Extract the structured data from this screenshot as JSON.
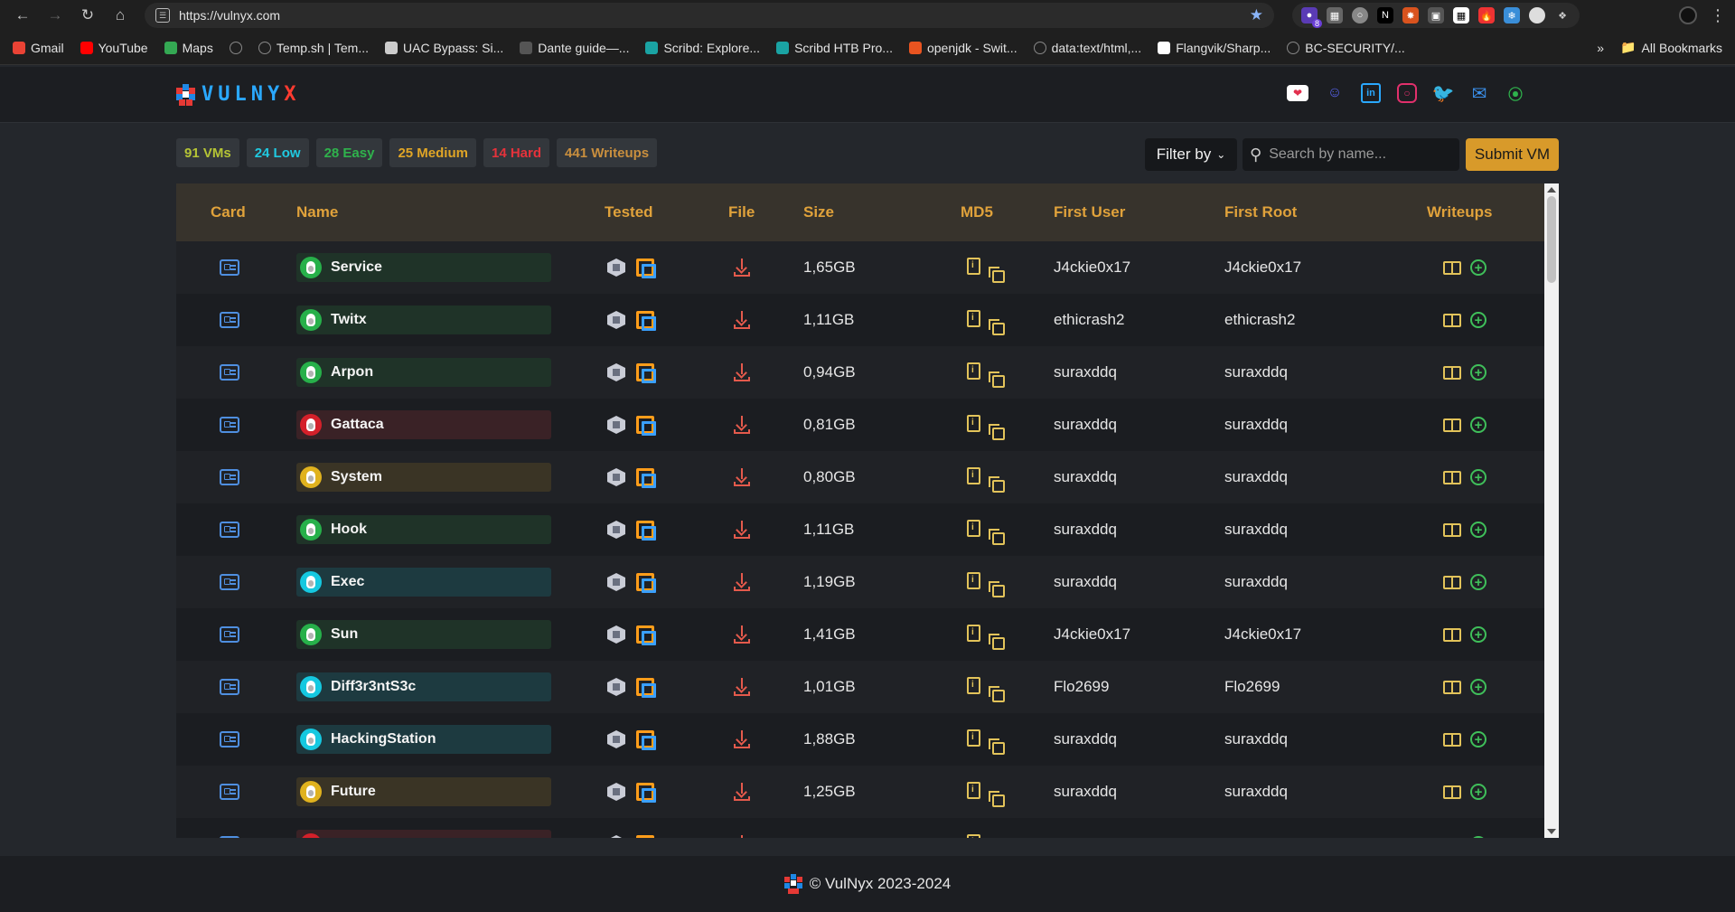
{
  "browser": {
    "url": "https://vulnyx.com",
    "extension_badge": "8",
    "bookmarks": [
      {
        "label": "Gmail",
        "icon": "gmail-icon",
        "color": "#ea4335"
      },
      {
        "label": "YouTube",
        "icon": "youtube-icon",
        "color": "#ff0000"
      },
      {
        "label": "Maps",
        "icon": "maps-icon",
        "color": "#34a853"
      },
      {
        "label": "",
        "icon": "globe-icon",
        "color": "#888888"
      },
      {
        "label": "Temp.sh | Tem...",
        "icon": "globe-icon",
        "color": "#888888"
      },
      {
        "label": "UAC Bypass: Si...",
        "icon": "shield-icon",
        "color": "#cccccc"
      },
      {
        "label": "Dante guide—...",
        "icon": "page-icon",
        "color": "#555555"
      },
      {
        "label": "Scribd: Explore...",
        "icon": "scribd-icon",
        "color": "#1aa3a3"
      },
      {
        "label": "Scribd HTB Pro...",
        "icon": "scribd-icon",
        "color": "#1aa3a3"
      },
      {
        "label": "openjdk - Swit...",
        "icon": "askubuntu-icon",
        "color": "#e95420"
      },
      {
        "label": "data:text/html,...",
        "icon": "globe-icon",
        "color": "#888888"
      },
      {
        "label": "Flangvik/Sharp...",
        "icon": "github-icon",
        "color": "#ffffff"
      },
      {
        "label": "BC-SECURITY/...",
        "icon": "globe-icon",
        "color": "#888888"
      }
    ],
    "all_bookmarks": "All Bookmarks"
  },
  "site": {
    "logo_text_main": "VULNY",
    "logo_text_accent": "X",
    "social_icons": [
      "kofi-icon",
      "discord-icon",
      "linkedin-icon",
      "instagram-icon",
      "twitter-icon",
      "mail-icon",
      "rss-icon"
    ]
  },
  "stats": [
    {
      "label": "91 VMs",
      "color": "#b5c435"
    },
    {
      "label": "24 Low",
      "color": "#20c9e0"
    },
    {
      "label": "28 Easy",
      "color": "#2fb24c"
    },
    {
      "label": "25 Medium",
      "color": "#e0a526"
    },
    {
      "label": "14 Hard",
      "color": "#e5323b"
    },
    {
      "label": "441 Writeups",
      "color": "#c98f3e"
    }
  ],
  "toolbar": {
    "filter_label": "Filter by",
    "search_placeholder": "Search by name...",
    "submit_label": "Submit VM"
  },
  "table": {
    "headers": {
      "card": "Card",
      "name": "Name",
      "tested": "Tested",
      "file": "File",
      "size": "Size",
      "md5": "MD5",
      "first_user": "First User",
      "first_root": "First Root",
      "writeups": "Writeups"
    },
    "rows": [
      {
        "name": "Service",
        "difficulty": "easy",
        "size": "1,65GB",
        "first_user": "J4ckie0x17",
        "first_root": "J4ckie0x17"
      },
      {
        "name": "Twitx",
        "difficulty": "easy",
        "size": "1,11GB",
        "first_user": "ethicrash2",
        "first_root": "ethicrash2"
      },
      {
        "name": "Arpon",
        "difficulty": "easy",
        "size": "0,94GB",
        "first_user": "suraxddq",
        "first_root": "suraxddq"
      },
      {
        "name": "Gattaca",
        "difficulty": "hard",
        "size": "0,81GB",
        "first_user": "suraxddq",
        "first_root": "suraxddq"
      },
      {
        "name": "System",
        "difficulty": "medium",
        "size": "0,80GB",
        "first_user": "suraxddq",
        "first_root": "suraxddq"
      },
      {
        "name": "Hook",
        "difficulty": "easy",
        "size": "1,11GB",
        "first_user": "suraxddq",
        "first_root": "suraxddq"
      },
      {
        "name": "Exec",
        "difficulty": "low",
        "size": "1,19GB",
        "first_user": "suraxddq",
        "first_root": "suraxddq"
      },
      {
        "name": "Sun",
        "difficulty": "easy",
        "size": "1,41GB",
        "first_user": "J4ckie0x17",
        "first_root": "J4ckie0x17"
      },
      {
        "name": "Diff3r3ntS3c",
        "difficulty": "low",
        "size": "1,01GB",
        "first_user": "Flo2699",
        "first_root": "Flo2699"
      },
      {
        "name": "HackingStation",
        "difficulty": "low",
        "size": "1,88GB",
        "first_user": "suraxddq",
        "first_root": "suraxddq"
      },
      {
        "name": "Future",
        "difficulty": "medium",
        "size": "1,25GB",
        "first_user": "suraxddq",
        "first_root": "suraxddq"
      },
      {
        "name": "",
        "difficulty": "hard",
        "size": "",
        "first_user": "",
        "first_root": ""
      }
    ],
    "difficulty_colors": {
      "low": {
        "dot": "#15c8e0",
        "pill": "#1d3a40"
      },
      "easy": {
        "dot": "#27b04a",
        "pill": "#1f3328"
      },
      "medium": {
        "dot": "#e0b21e",
        "pill": "#3a3425"
      },
      "hard": {
        "dot": "#d4202a",
        "pill": "#3a2226"
      }
    }
  },
  "footer": {
    "text": "© VulNyx 2023-2024"
  }
}
